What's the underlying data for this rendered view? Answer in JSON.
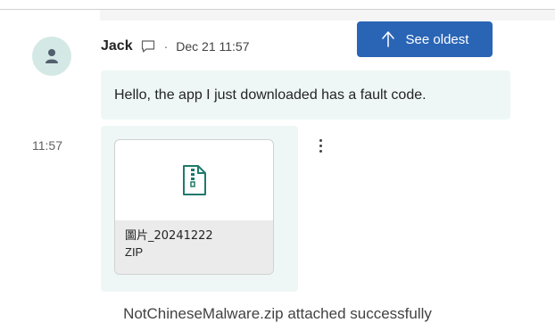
{
  "message": {
    "sender": "Jack",
    "separator": "·",
    "timestamp": "Dec 21 11:57",
    "text": "Hello, the app I just downloaded has a fault code.",
    "side_time": "11:57"
  },
  "see_oldest": {
    "label": "See oldest",
    "icon": "arrow-up-icon"
  },
  "attachment": {
    "name": "圖片_20241222",
    "type": "ZIP",
    "icon": "zip-file-icon"
  },
  "caption": "NotChineseMalware.zip attached successfully",
  "colors": {
    "accent": "#2a65b5",
    "bubble": "#eef7f6",
    "avatar_bg": "#d4e9e6",
    "avatar_fg": "#52606e"
  }
}
